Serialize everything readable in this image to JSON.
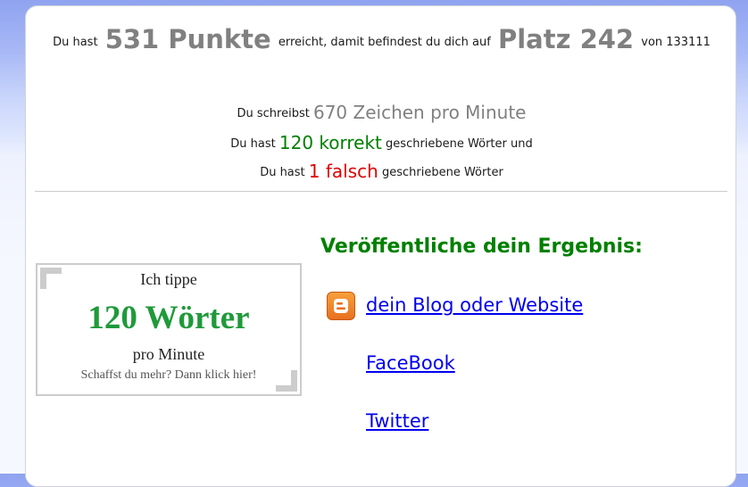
{
  "result": {
    "prefix": "Du hast",
    "points": "531 Punkte",
    "middle": "erreicht, damit befindest du dich auf",
    "rank": "Platz 242",
    "suffix": "von 133111"
  },
  "stats": {
    "speed_prefix": "Du schreibst",
    "speed": "670 Zeichen pro Minute",
    "correct_prefix": "Du hast",
    "correct": "120 korrekt",
    "correct_suffix": "geschriebene Wörter und",
    "wrong_prefix": "Du hast",
    "wrong": "1 falsch",
    "wrong_suffix": "geschriebene Wörter"
  },
  "badge": {
    "line1": "Ich tippe",
    "words": "120 Wörter",
    "line3": "pro Minute",
    "line4": "Schaffst du mehr? Dann klick hier!"
  },
  "publish": {
    "title": "Veröffentliche dein Ergebnis:",
    "links": [
      {
        "label": "dein Blog oder Website",
        "icon": "blogger-icon"
      },
      {
        "label": "FaceBook"
      },
      {
        "label": "Twitter"
      }
    ]
  },
  "colors": {
    "green": "#008000",
    "badge_green": "#1f9a3a",
    "red": "#e00000",
    "gray": "#808080",
    "link": "#0000ee",
    "blogger_orange": "#f57d00"
  }
}
